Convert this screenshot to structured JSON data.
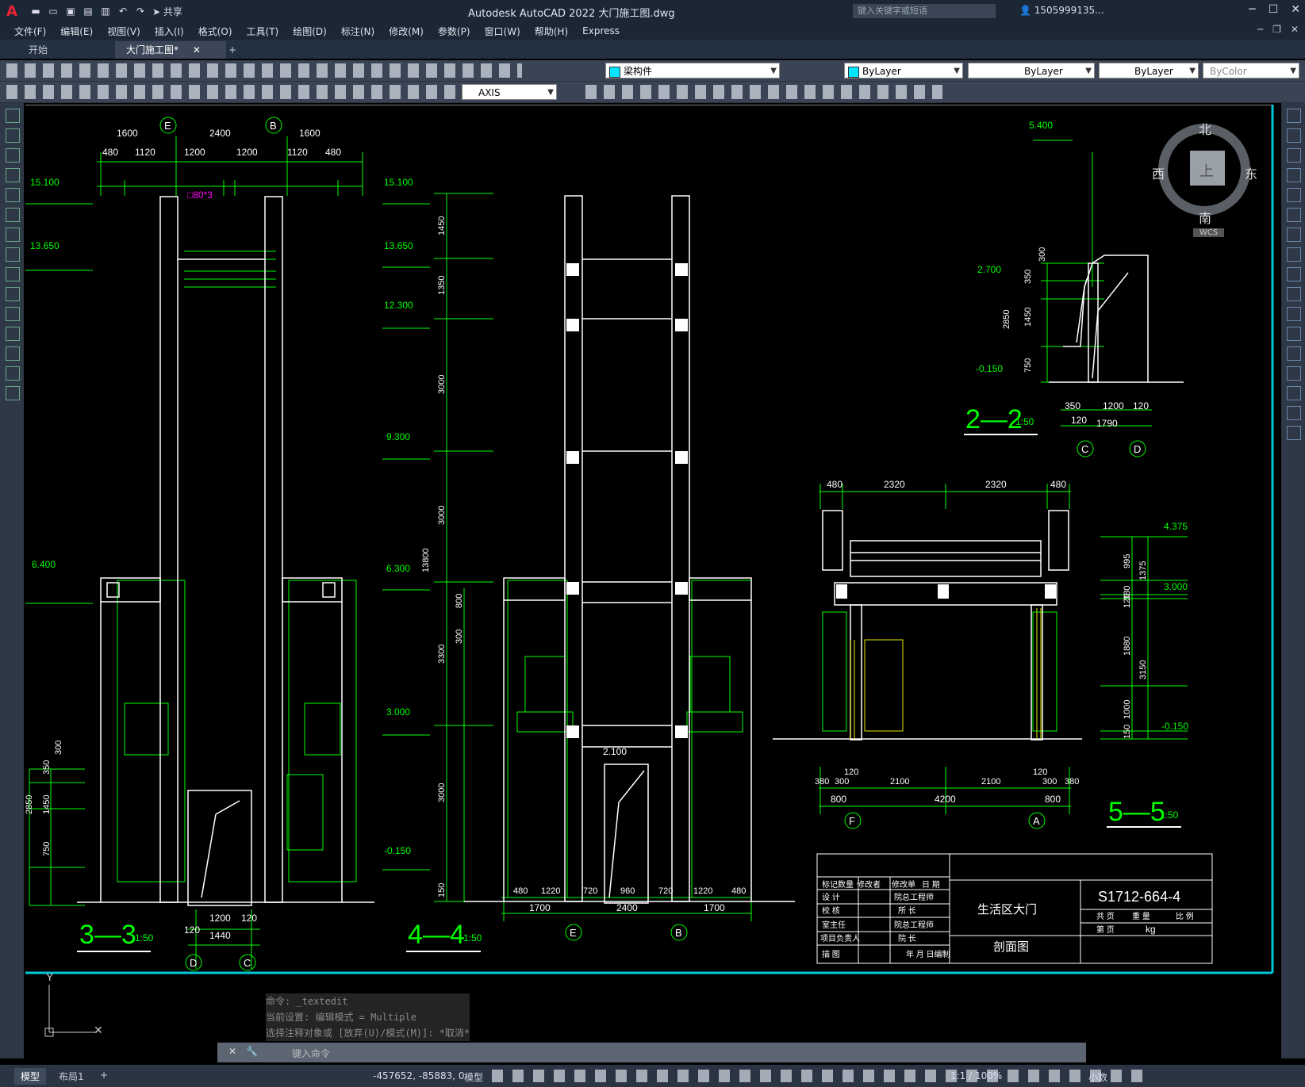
{
  "app": {
    "title": "Autodesk AutoCAD 2022    大门施工图.dwg",
    "search_placeholder": "键入关键字或短语",
    "user": "1505999135...",
    "share": "共享",
    "logo": "A"
  },
  "menu": [
    "文件(F)",
    "编辑(E)",
    "视图(V)",
    "插入(I)",
    "格式(O)",
    "工具(T)",
    "绘图(D)",
    "标注(N)",
    "修改(M)",
    "参数(P)",
    "窗口(W)",
    "帮助(H)",
    "Express"
  ],
  "tabs": {
    "start": "开始",
    "doc": "大门施工图*",
    "add": "+"
  },
  "toolbar": {
    "layer": "梁构件",
    "color": "ByLayer",
    "linetype": "ByLayer",
    "lineweight": "ByLayer",
    "plotstyle": "ByColor",
    "dimstyle": "AXIS"
  },
  "viewcube": {
    "north": "北",
    "south": "南",
    "east": "东",
    "west": "西",
    "top": "上",
    "wcs": "WCS"
  },
  "command": {
    "history": [
      "命令: _textedit",
      "当前设置: 编辑模式 = Multiple",
      "选择注释对象或 [放弃(U)/模式(M)]: *取消*"
    ],
    "placeholder": "键入命令"
  },
  "status": {
    "model_tab": "模型",
    "layout_tab": "布局1",
    "add": "+",
    "coords": "-457652, -85883, 0",
    "model_btn": "模型",
    "scale": "1:1 / 100%",
    "units": "小数"
  },
  "drawing": {
    "s33": {
      "top_dims": [
        "1600",
        "2400",
        "1600"
      ],
      "sub_dims": [
        "480",
        "1120",
        "1200",
        "1200",
        "1120",
        "480"
      ],
      "axis_top": [
        "E",
        "B"
      ],
      "levels": [
        "15.100",
        "13.650",
        "6.400"
      ],
      "beam_note": "□80*3",
      "left_dims": [
        "300",
        "350",
        "1450",
        "750"
      ],
      "total_left": "2850",
      "bottom_dims": [
        "1200",
        "120",
        "120"
      ],
      "bottom_total": "1440",
      "axis_bottom": [
        "D",
        "C"
      ],
      "title": "3—3",
      "scale": "1:50"
    },
    "s44": {
      "levels": [
        "15.100",
        "13.650",
        "12.300",
        "9.300",
        "6.300",
        "3.000",
        "-0.150",
        "2.100"
      ],
      "vert_dims": [
        "1450",
        "1350",
        "3000",
        "3000",
        "3300",
        "3000",
        "150"
      ],
      "total": "13800",
      "small_dims": [
        "800",
        "300"
      ],
      "bottom_dims": [
        "480",
        "1220",
        "720",
        "960",
        "720",
        "1220",
        "480"
      ],
      "bottom_totals": [
        "1700",
        "2400",
        "1700"
      ],
      "axis_bottom": [
        "E",
        "B"
      ],
      "title": "4—4",
      "scale": "1:50"
    },
    "s22": {
      "levels": [
        "5.400",
        "2.700",
        "-0.150"
      ],
      "vert_dims": [
        "300",
        "350",
        "1450",
        "750"
      ],
      "total": "2850",
      "bottom_dims": [
        "350",
        "1200",
        "120",
        "120"
      ],
      "bottom_total": "1790",
      "axis": [
        "C",
        "D"
      ],
      "title": "2—2",
      "scale": "1:50"
    },
    "s55": {
      "top_dims": [
        "480",
        "2320",
        "2320",
        "480"
      ],
      "levels": [
        "4.375",
        "3.000",
        "-0.150"
      ],
      "right_dims": [
        "995",
        "380",
        "120",
        "1880",
        "1000",
        "150"
      ],
      "right_totals": [
        "1375",
        "3150"
      ],
      "bottom_dims": [
        "380",
        "300",
        "120",
        "2100",
        "2100",
        "120",
        "300",
        "380"
      ],
      "bottom_totals": [
        "800",
        "4200",
        "800"
      ],
      "axis": [
        "F",
        "A"
      ],
      "title": "5—5",
      "scale": "1:50"
    },
    "titleblock": {
      "project": "生活区大门",
      "drawing_name": "剖面图",
      "number": "S1712-664-4",
      "unit": "kg",
      "rows": [
        "设 计",
        "校 核",
        "室主任",
        "项目负责人",
        "描 图"
      ],
      "cols": [
        "标记",
        "数量",
        "修改者",
        "修改单",
        "日 期"
      ],
      "right_rows": [
        "院总工程师",
        "所 长",
        "院总工程师",
        "院 长",
        "年 月 日编制"
      ],
      "top_right": [
        "共 页",
        "重 量",
        "比 例",
        "第 页"
      ]
    }
  }
}
